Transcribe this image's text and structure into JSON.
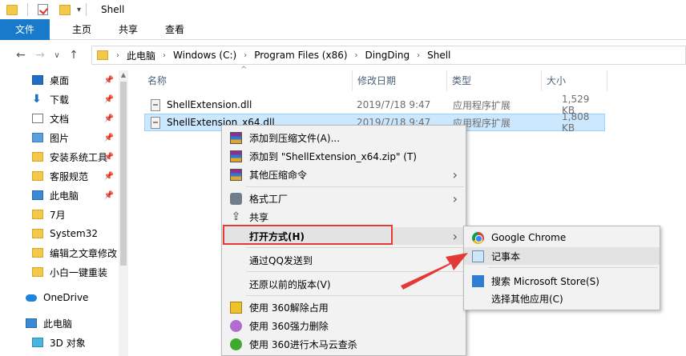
{
  "window": {
    "title": "Shell"
  },
  "ribbon": {
    "tabs": [
      "文件",
      "主页",
      "共享",
      "查看"
    ]
  },
  "address": {
    "crumbs": [
      "此电脑",
      "Windows (C:)",
      "Program Files (x86)",
      "DingDing",
      "Shell"
    ]
  },
  "nav": {
    "items": [
      {
        "label": "桌面",
        "icon": "desktop-icon",
        "pinned": true
      },
      {
        "label": "下载",
        "icon": "download-icon",
        "pinned": true
      },
      {
        "label": "文档",
        "icon": "document-icon",
        "pinned": true
      },
      {
        "label": "图片",
        "icon": "picture-icon",
        "pinned": true
      },
      {
        "label": "安装系统工具",
        "icon": "folder-icon",
        "pinned": true
      },
      {
        "label": "客服规范",
        "icon": "folder-icon",
        "pinned": true
      },
      {
        "label": "此电脑",
        "icon": "pc-icon",
        "pinned": true
      },
      {
        "label": "7月",
        "icon": "folder-icon",
        "pinned": false
      },
      {
        "label": "System32",
        "icon": "folder-icon",
        "pinned": false
      },
      {
        "label": "编辑之文章修改",
        "icon": "folder-icon",
        "pinned": false
      },
      {
        "label": "小白一键重装",
        "icon": "folder-icon",
        "pinned": false
      },
      {
        "label": "OneDrive",
        "icon": "onedrive-icon",
        "pinned": false
      },
      {
        "label": "此电脑",
        "icon": "pc-icon",
        "pinned": false
      },
      {
        "label": "3D 对象",
        "icon": "3d-objects-icon",
        "pinned": false
      }
    ]
  },
  "columns": {
    "name": "名称",
    "date": "修改日期",
    "type": "类型",
    "size": "大小"
  },
  "files": [
    {
      "name": "ShellExtension.dll",
      "date": "2019/7/18 9:47",
      "type": "应用程序扩展",
      "size": "1,529 KB"
    },
    {
      "name": "ShellExtension_x64.dll",
      "date": "2019/7/18 9:47",
      "type": "应用程序扩展",
      "size": "1,808 KB"
    }
  ],
  "context_menu": {
    "items": [
      {
        "label": "添加到压缩文件(A)...",
        "icon": "winrar-icon"
      },
      {
        "label": "添加到 \"ShellExtension_x64.zip\" (T)",
        "icon": "winrar-icon"
      },
      {
        "label": "其他压缩命令",
        "icon": "winrar-icon"
      },
      {
        "label": "格式工厂",
        "icon": "format-factory-icon"
      },
      {
        "label": "共享",
        "icon": "share-icon"
      },
      {
        "label": "打开方式(H)",
        "icon": ""
      },
      {
        "label": "通过QQ发送到",
        "icon": ""
      },
      {
        "label": "还原以前的版本(V)",
        "icon": ""
      },
      {
        "label": "使用 360解除占用",
        "icon": "360-unlock-icon"
      },
      {
        "label": "使用 360强力删除",
        "icon": "360-delete-icon"
      },
      {
        "label": "使用 360进行木马云查杀",
        "icon": "360-scan-icon"
      }
    ]
  },
  "submenu": {
    "items": [
      {
        "label": "Google Chrome",
        "icon": "chrome-icon"
      },
      {
        "label": "记事本",
        "icon": "notepad-icon"
      },
      {
        "label": "搜索 Microsoft Store(S)",
        "icon": "store-icon"
      },
      {
        "label": "选择其他应用(C)",
        "icon": ""
      }
    ]
  },
  "colors": {
    "accent": "#1979ca",
    "selection": "#cce8ff",
    "highlight_box": "#e53935"
  }
}
